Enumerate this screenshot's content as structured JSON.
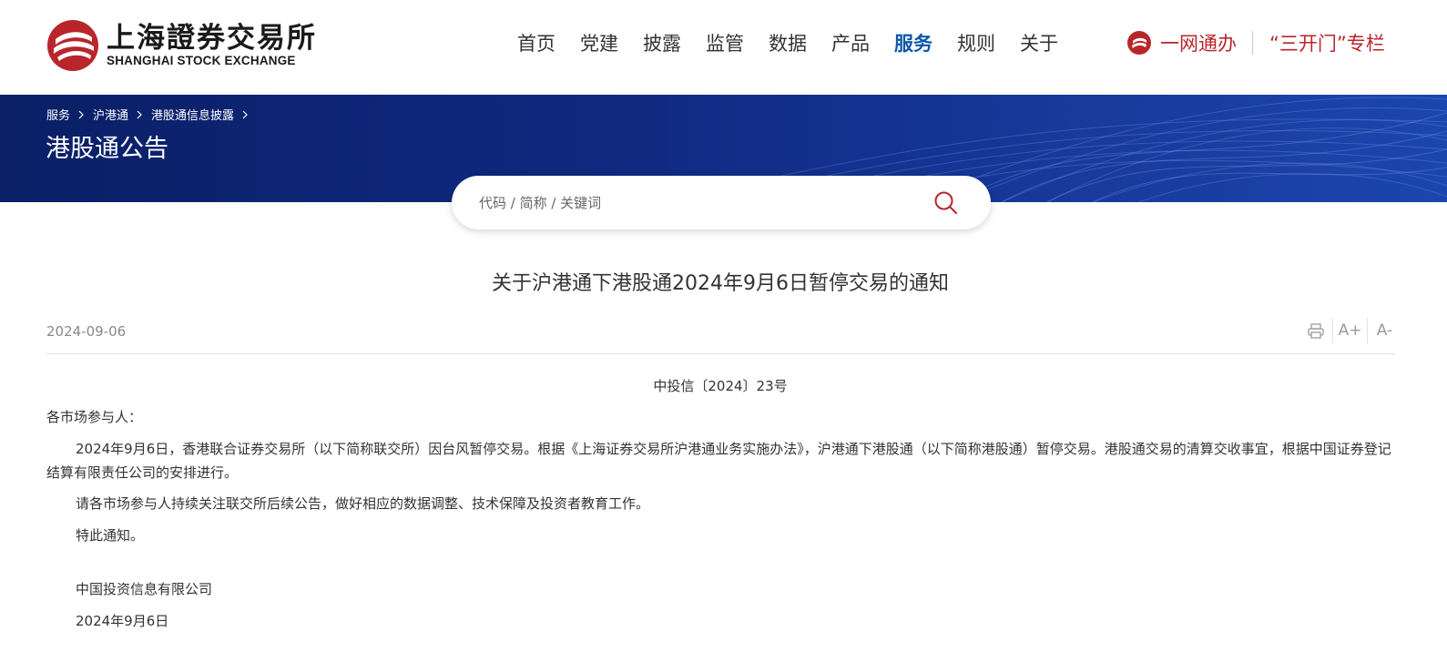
{
  "header": {
    "logo_cn": "上海證券交易所",
    "logo_en": "SHANGHAI STOCK EXCHANGE",
    "nav": [
      {
        "label": "首页"
      },
      {
        "label": "党建"
      },
      {
        "label": "披露"
      },
      {
        "label": "监管"
      },
      {
        "label": "数据"
      },
      {
        "label": "产品"
      },
      {
        "label": "服务",
        "active": true
      },
      {
        "label": "规则"
      },
      {
        "label": "关于"
      }
    ],
    "quick_links": {
      "one_network": "一网通办",
      "three_doors": "“三开门”专栏"
    }
  },
  "banner": {
    "breadcrumb": [
      "服务",
      "沪港通",
      "港股通信息披露"
    ],
    "page_title": "港股通公告"
  },
  "search": {
    "placeholder": "代码 / 简称 / 关键词",
    "value": ""
  },
  "article": {
    "title": "关于沪港通下港股通2024年9月6日暂停交易的通知",
    "date": "2024-09-06",
    "tools": {
      "print_icon": "printer-icon",
      "font_increase": "A+",
      "font_decrease": "A-"
    },
    "doc_number": "中投信〔2024〕23号",
    "salutation": "各市场参与人：",
    "paragraphs": [
      "2024年9月6日，香港联合证券交易所（以下简称联交所）因台风暂停交易。根据《上海证券交易所沪港通业务实施办法》，沪港通下港股通（以下简称港股通）暂停交易。港股通交易的清算交收事宜，根据中国证券登记结算有限责任公司的安排进行。",
      "请各市场参与人持续关注联交所后续公告，做好相应的数据调整、技术保障及投资者教育工作。",
      "特此通知。"
    ],
    "signature_org": "中国投资信息有限公司",
    "signature_date": "2024年9月6日"
  },
  "colors": {
    "brand_red": "#b8262c",
    "nav_active": "#0b57a8",
    "banner_blue": "#102a82"
  }
}
